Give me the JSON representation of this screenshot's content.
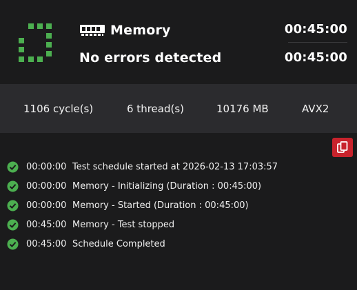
{
  "header": {
    "icon": "ram-icon",
    "title": "Memory",
    "status": "No errors detected",
    "elapsed": "00:45:00",
    "total": "00:45:00",
    "status_icon": "dashed-square-icon",
    "accent_color": "#4caf50"
  },
  "stats": {
    "cycles": "1106 cycle(s)",
    "threads": "6 thread(s)",
    "memory": "10176 MB",
    "instruction_set": "AVX2"
  },
  "copy_button": {
    "icon": "copy-icon",
    "color": "#c8232c"
  },
  "log": {
    "entries": [
      {
        "time": "00:00:00",
        "message": "Test schedule started at 2026-02-13 17:03:57",
        "icon": "check-circle-icon"
      },
      {
        "time": "00:00:00",
        "message": "Memory - Initializing (Duration : 00:45:00)",
        "icon": "check-circle-icon"
      },
      {
        "time": "00:00:00",
        "message": "Memory - Started (Duration : 00:45:00)",
        "icon": "check-circle-icon"
      },
      {
        "time": "00:45:00",
        "message": "Memory - Test stopped",
        "icon": "check-circle-icon"
      },
      {
        "time": "00:45:00",
        "message": "Schedule Completed",
        "icon": "check-circle-icon"
      }
    ]
  }
}
